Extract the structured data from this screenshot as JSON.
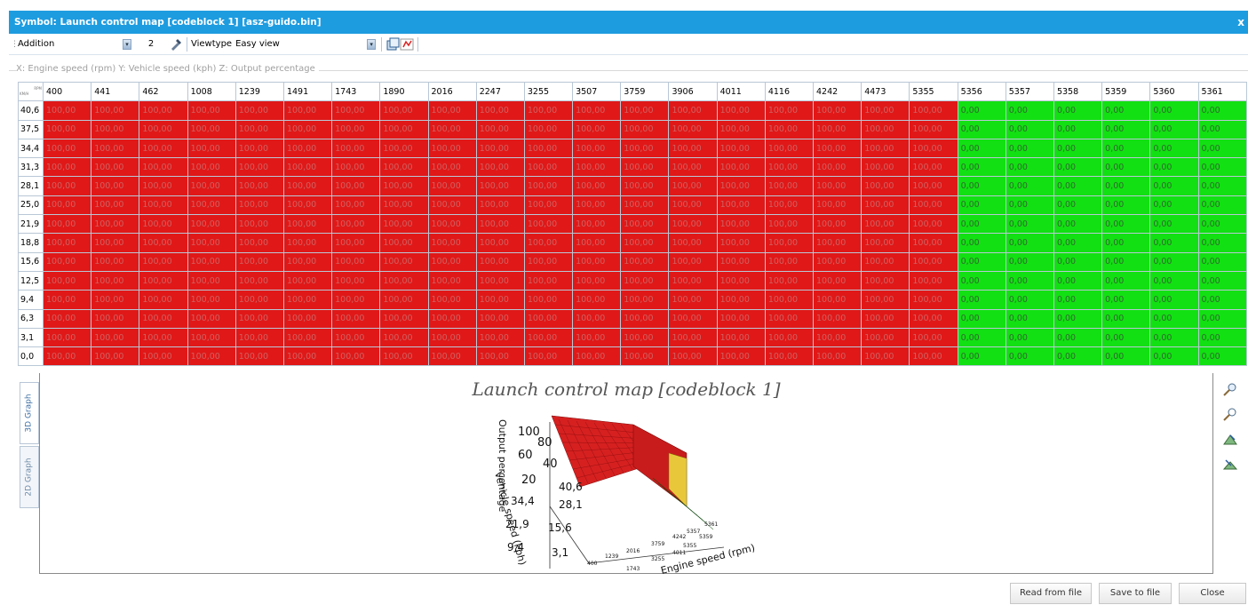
{
  "window": {
    "title": "Symbol: Launch control map [codeblock 1] [asz-guido.bin]",
    "close_glyph": "x"
  },
  "toolbar": {
    "operation_value": "Addition",
    "amount_value": "2",
    "viewtype_label": "Viewtype",
    "viewtype_value": "Easy view"
  },
  "axis_legend": "X: Engine speed (rpm) Y: Vehicle speed (kph) Z: Output percentage",
  "table": {
    "corner_top": "RPM",
    "corner_bottom": "KM/H",
    "columns": [
      "400",
      "441",
      "462",
      "1008",
      "1239",
      "1491",
      "1743",
      "1890",
      "2016",
      "2247",
      "3255",
      "3507",
      "3759",
      "3906",
      "4011",
      "4116",
      "4242",
      "4473",
      "5355",
      "5356",
      "5357",
      "5358",
      "5359",
      "5360",
      "5361"
    ],
    "rows": [
      "40,6",
      "37,5",
      "34,4",
      "31,3",
      "28,1",
      "25,0",
      "21,9",
      "18,8",
      "15,6",
      "12,5",
      "9,4",
      "6,3",
      "3,1",
      "0,0"
    ],
    "high_value": "100,00",
    "low_value": "0,00",
    "high_color": "#e01818",
    "low_color": "#12e012",
    "high_column_count": 19
  },
  "graph": {
    "title": "Launch control map [codeblock 1]",
    "tabs": [
      "3D Graph",
      "2D Graph"
    ],
    "active_tab": "3D Graph",
    "z_axis_label": "Output percentage",
    "z_ticks": [
      "100",
      "80",
      "60",
      "40",
      "20"
    ],
    "y_axis_label": "Vehicle speed (kph)",
    "y_ticks": [
      "40,6",
      "34,4",
      "28,1",
      "21,9",
      "15,6",
      "9,4",
      "3,1"
    ],
    "x_axis_label": "Engine speed (rpm)",
    "x_ticks": [
      "400",
      "1239",
      "1743",
      "2016",
      "3255",
      "3759",
      "4011",
      "4242",
      "5355",
      "5357",
      "5359",
      "5361"
    ]
  },
  "side_tools": [
    "zoom-in-icon",
    "zoom-out-icon",
    "rotate-up-icon",
    "rotate-down-icon"
  ],
  "footer": {
    "read_label": "Read from file",
    "save_label": "Save to file",
    "close_label": "Close"
  }
}
